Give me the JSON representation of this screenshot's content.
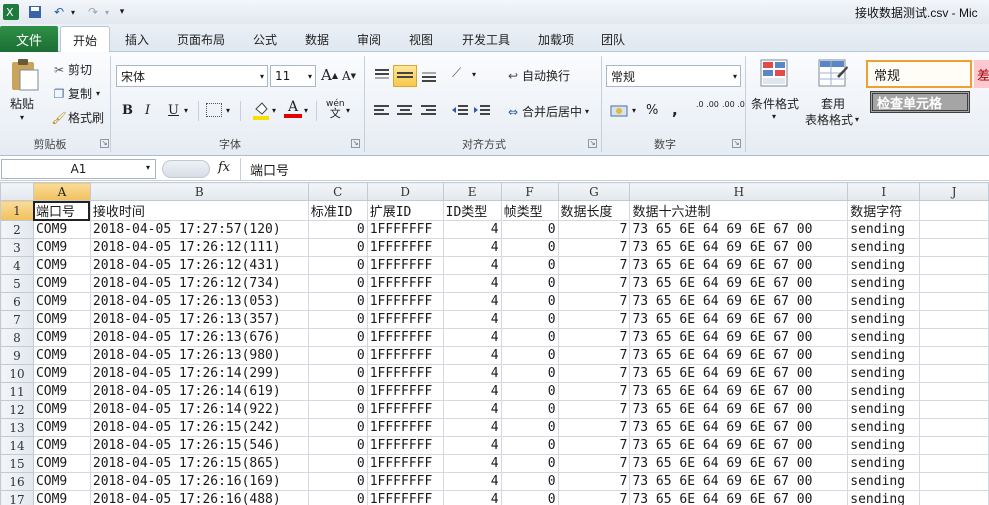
{
  "window": {
    "title": "接收数据测试.csv - Mic"
  },
  "tabs": {
    "file": "文件",
    "home": "开始",
    "insert": "插入",
    "layout": "页面布局",
    "formulas": "公式",
    "data": "数据",
    "review": "审阅",
    "view": "视图",
    "developer": "开发工具",
    "addins": "加载项",
    "team": "团队"
  },
  "clipboard": {
    "paste": "粘贴",
    "cut": "剪切",
    "copy": "复制",
    "painter": "格式刷",
    "label": "剪贴板"
  },
  "font": {
    "name": "宋体",
    "size": "11",
    "bold": "B",
    "italic": "I",
    "underline": "U",
    "grow": "A",
    "shrink": "A",
    "font_color": "A",
    "wen": "wén",
    "label": "字体"
  },
  "alignment": {
    "wrap": "自动换行",
    "merge": "合并后居中",
    "label": "对齐方式"
  },
  "number": {
    "format": "常规",
    "percent": "%",
    "comma": ",",
    "inc_dec": ".0 .00",
    "dec_dec": ".00 .0",
    "label": "数字"
  },
  "styles": {
    "conditional": "条件格式",
    "table_line1": "套用",
    "table_line2": "表格格式",
    "normal": "常规",
    "check_cell": "检查单元格",
    "bad": "差"
  },
  "formula_bar": {
    "name_box": "A1",
    "fx": "fx",
    "content": "端口号"
  },
  "columns": [
    "A",
    "B",
    "C",
    "D",
    "E",
    "F",
    "G",
    "H",
    "I",
    "J"
  ],
  "header_row": [
    "端口号",
    "接收时间",
    "标准ID",
    "扩展ID",
    "ID类型",
    "帧类型",
    "数据长度",
    "数据十六进制",
    "数据字符",
    ""
  ],
  "rows": [
    [
      "COM9",
      "2018-04-05 17:27:57(120)",
      "0",
      "1FFFFFFF",
      "4",
      "0",
      "7",
      "73 65 6E 64 69 6E 67 00",
      "sending"
    ],
    [
      "COM9",
      "2018-04-05 17:26:12(111)",
      "0",
      "1FFFFFFF",
      "4",
      "0",
      "7",
      "73 65 6E 64 69 6E 67 00",
      "sending"
    ],
    [
      "COM9",
      "2018-04-05 17:26:12(431)",
      "0",
      "1FFFFFFF",
      "4",
      "0",
      "7",
      "73 65 6E 64 69 6E 67 00",
      "sending"
    ],
    [
      "COM9",
      "2018-04-05 17:26:12(734)",
      "0",
      "1FFFFFFF",
      "4",
      "0",
      "7",
      "73 65 6E 64 69 6E 67 00",
      "sending"
    ],
    [
      "COM9",
      "2018-04-05 17:26:13(053)",
      "0",
      "1FFFFFFF",
      "4",
      "0",
      "7",
      "73 65 6E 64 69 6E 67 00",
      "sending"
    ],
    [
      "COM9",
      "2018-04-05 17:26:13(357)",
      "0",
      "1FFFFFFF",
      "4",
      "0",
      "7",
      "73 65 6E 64 69 6E 67 00",
      "sending"
    ],
    [
      "COM9",
      "2018-04-05 17:26:13(676)",
      "0",
      "1FFFFFFF",
      "4",
      "0",
      "7",
      "73 65 6E 64 69 6E 67 00",
      "sending"
    ],
    [
      "COM9",
      "2018-04-05 17:26:13(980)",
      "0",
      "1FFFFFFF",
      "4",
      "0",
      "7",
      "73 65 6E 64 69 6E 67 00",
      "sending"
    ],
    [
      "COM9",
      "2018-04-05 17:26:14(299)",
      "0",
      "1FFFFFFF",
      "4",
      "0",
      "7",
      "73 65 6E 64 69 6E 67 00",
      "sending"
    ],
    [
      "COM9",
      "2018-04-05 17:26:14(619)",
      "0",
      "1FFFFFFF",
      "4",
      "0",
      "7",
      "73 65 6E 64 69 6E 67 00",
      "sending"
    ],
    [
      "COM9",
      "2018-04-05 17:26:14(922)",
      "0",
      "1FFFFFFF",
      "4",
      "0",
      "7",
      "73 65 6E 64 69 6E 67 00",
      "sending"
    ],
    [
      "COM9",
      "2018-04-05 17:26:15(242)",
      "0",
      "1FFFFFFF",
      "4",
      "0",
      "7",
      "73 65 6E 64 69 6E 67 00",
      "sending"
    ],
    [
      "COM9",
      "2018-04-05 17:26:15(546)",
      "0",
      "1FFFFFFF",
      "4",
      "0",
      "7",
      "73 65 6E 64 69 6E 67 00",
      "sending"
    ],
    [
      "COM9",
      "2018-04-05 17:26:15(865)",
      "0",
      "1FFFFFFF",
      "4",
      "0",
      "7",
      "73 65 6E 64 69 6E 67 00",
      "sending"
    ],
    [
      "COM9",
      "2018-04-05 17:26:16(169)",
      "0",
      "1FFFFFFF",
      "4",
      "0",
      "7",
      "73 65 6E 64 69 6E 67 00",
      "sending"
    ],
    [
      "COM9",
      "2018-04-05 17:26:16(488)",
      "0",
      "1FFFFFFF",
      "4",
      "0",
      "7",
      "73 65 6E 64 69 6E 67 00",
      "sending"
    ]
  ]
}
